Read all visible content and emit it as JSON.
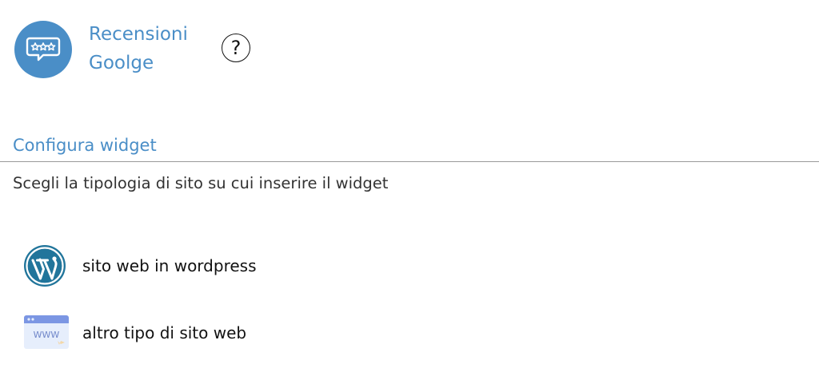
{
  "header": {
    "app_title": "Recensioni Goolge",
    "logo_icon": "review-stars-chat-icon",
    "help_label": "?",
    "help_icon": "question-circle-icon",
    "accent_color": "#4a8ec7"
  },
  "section": {
    "title": "Configura widget",
    "description": "Scegli la tipologia di sito su cui inserire il widget"
  },
  "options": [
    {
      "label": "sito web in wordpress",
      "icon": "wordpress-icon"
    },
    {
      "label": "altro tipo di sito web",
      "icon": "www-browser-icon",
      "icon_text": "WWW"
    }
  ]
}
